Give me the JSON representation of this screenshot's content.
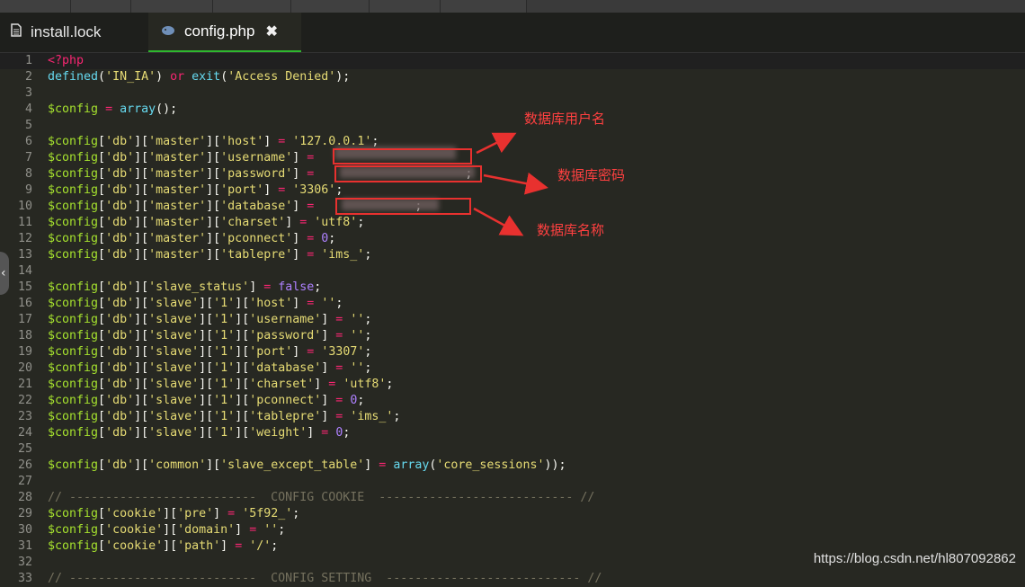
{
  "tabs": [
    {
      "label": "install.lock",
      "icon": "file-icon",
      "active": false
    },
    {
      "label": "config.php",
      "icon": "php-elephant-icon",
      "active": true,
      "close": "✖"
    }
  ],
  "annotations": {
    "username": "数据库用户名",
    "password": "数据库密码",
    "database": "数据库名称"
  },
  "watermark": "https://blog.csdn.net/hl807092862",
  "colors": {
    "accent_tab": "#2eb82e",
    "annotation": "#e8312f",
    "editor_bg": "#272822"
  },
  "lines": [
    {
      "n": "1",
      "t": [
        [
          "k",
          "<?php"
        ]
      ]
    },
    {
      "n": "2",
      "t": [
        [
          "f",
          "defined"
        ],
        [
          "p",
          "("
        ],
        [
          "s",
          "'IN_IA'"
        ],
        [
          "p",
          ") "
        ],
        [
          "k",
          "or"
        ],
        [
          "p",
          " "
        ],
        [
          "f",
          "exit"
        ],
        [
          "p",
          "("
        ],
        [
          "s",
          "'Access Denied'"
        ],
        [
          "p",
          ");"
        ]
      ]
    },
    {
      "n": "3",
      "t": []
    },
    {
      "n": "4",
      "t": [
        [
          "v",
          "$config"
        ],
        [
          "p",
          " "
        ],
        [
          "k",
          "="
        ],
        [
          "p",
          " "
        ],
        [
          "f",
          "array"
        ],
        [
          "p",
          "();"
        ]
      ]
    },
    {
      "n": "5",
      "t": []
    },
    {
      "n": "6",
      "t": [
        [
          "v",
          "$config"
        ],
        [
          "p",
          "["
        ],
        [
          "s",
          "'db'"
        ],
        [
          "p",
          "]["
        ],
        [
          "s",
          "'master'"
        ],
        [
          "p",
          "]["
        ],
        [
          "s",
          "'host'"
        ],
        [
          "p",
          "] "
        ],
        [
          "k",
          "="
        ],
        [
          "p",
          " "
        ],
        [
          "s",
          "'127.0.0.1'"
        ],
        [
          "p",
          ";"
        ]
      ]
    },
    {
      "n": "7",
      "t": [
        [
          "v",
          "$config"
        ],
        [
          "p",
          "["
        ],
        [
          "s",
          "'db'"
        ],
        [
          "p",
          "]["
        ],
        [
          "s",
          "'master'"
        ],
        [
          "p",
          "]["
        ],
        [
          "s",
          "'username'"
        ],
        [
          "p",
          "] "
        ],
        [
          "k",
          "="
        ],
        [
          "p",
          " "
        ]
      ]
    },
    {
      "n": "8",
      "t": [
        [
          "v",
          "$config"
        ],
        [
          "p",
          "["
        ],
        [
          "s",
          "'db'"
        ],
        [
          "p",
          "]["
        ],
        [
          "s",
          "'master'"
        ],
        [
          "p",
          "]["
        ],
        [
          "s",
          "'password'"
        ],
        [
          "p",
          "] "
        ],
        [
          "k",
          "="
        ],
        [
          "p",
          " "
        ],
        [
          "p",
          "                    ;"
        ]
      ]
    },
    {
      "n": "9",
      "t": [
        [
          "v",
          "$config"
        ],
        [
          "p",
          "["
        ],
        [
          "s",
          "'db'"
        ],
        [
          "p",
          "]["
        ],
        [
          "s",
          "'master'"
        ],
        [
          "p",
          "]["
        ],
        [
          "s",
          "'port'"
        ],
        [
          "p",
          "] "
        ],
        [
          "k",
          "="
        ],
        [
          "p",
          " "
        ],
        [
          "s",
          "'3306'"
        ],
        [
          "p",
          ";"
        ]
      ]
    },
    {
      "n": "10",
      "t": [
        [
          "v",
          "$config"
        ],
        [
          "p",
          "["
        ],
        [
          "s",
          "'db'"
        ],
        [
          "p",
          "]["
        ],
        [
          "s",
          "'master'"
        ],
        [
          "p",
          "]["
        ],
        [
          "s",
          "'database'"
        ],
        [
          "p",
          "] "
        ],
        [
          "k",
          "="
        ],
        [
          "p",
          " "
        ],
        [
          "p",
          "             ;"
        ]
      ]
    },
    {
      "n": "11",
      "t": [
        [
          "v",
          "$config"
        ],
        [
          "p",
          "["
        ],
        [
          "s",
          "'db'"
        ],
        [
          "p",
          "]["
        ],
        [
          "s",
          "'master'"
        ],
        [
          "p",
          "]["
        ],
        [
          "s",
          "'charset'"
        ],
        [
          "p",
          "] "
        ],
        [
          "k",
          "="
        ],
        [
          "p",
          " "
        ],
        [
          "s",
          "'utf8'"
        ],
        [
          "p",
          ";"
        ]
      ]
    },
    {
      "n": "12",
      "t": [
        [
          "v",
          "$config"
        ],
        [
          "p",
          "["
        ],
        [
          "s",
          "'db'"
        ],
        [
          "p",
          "]["
        ],
        [
          "s",
          "'master'"
        ],
        [
          "p",
          "]["
        ],
        [
          "s",
          "'pconnect'"
        ],
        [
          "p",
          "] "
        ],
        [
          "k",
          "="
        ],
        [
          "p",
          " "
        ],
        [
          "n",
          "0"
        ],
        [
          "p",
          ";"
        ]
      ]
    },
    {
      "n": "13",
      "t": [
        [
          "v",
          "$config"
        ],
        [
          "p",
          "["
        ],
        [
          "s",
          "'db'"
        ],
        [
          "p",
          "]["
        ],
        [
          "s",
          "'master'"
        ],
        [
          "p",
          "]["
        ],
        [
          "s",
          "'tablepre'"
        ],
        [
          "p",
          "] "
        ],
        [
          "k",
          "="
        ],
        [
          "p",
          " "
        ],
        [
          "s",
          "'ims_'"
        ],
        [
          "p",
          ";"
        ]
      ]
    },
    {
      "n": "14",
      "t": []
    },
    {
      "n": "15",
      "t": [
        [
          "v",
          "$config"
        ],
        [
          "p",
          "["
        ],
        [
          "s",
          "'db'"
        ],
        [
          "p",
          "]["
        ],
        [
          "s",
          "'slave_status'"
        ],
        [
          "p",
          "] "
        ],
        [
          "k",
          "="
        ],
        [
          "p",
          " "
        ],
        [
          "n",
          "false"
        ],
        [
          "p",
          ";"
        ]
      ]
    },
    {
      "n": "16",
      "t": [
        [
          "v",
          "$config"
        ],
        [
          "p",
          "["
        ],
        [
          "s",
          "'db'"
        ],
        [
          "p",
          "]["
        ],
        [
          "s",
          "'slave'"
        ],
        [
          "p",
          "]["
        ],
        [
          "s",
          "'1'"
        ],
        [
          "p",
          "]["
        ],
        [
          "s",
          "'host'"
        ],
        [
          "p",
          "] "
        ],
        [
          "k",
          "="
        ],
        [
          "p",
          " "
        ],
        [
          "s",
          "''"
        ],
        [
          "p",
          ";"
        ]
      ]
    },
    {
      "n": "17",
      "t": [
        [
          "v",
          "$config"
        ],
        [
          "p",
          "["
        ],
        [
          "s",
          "'db'"
        ],
        [
          "p",
          "]["
        ],
        [
          "s",
          "'slave'"
        ],
        [
          "p",
          "]["
        ],
        [
          "s",
          "'1'"
        ],
        [
          "p",
          "]["
        ],
        [
          "s",
          "'username'"
        ],
        [
          "p",
          "] "
        ],
        [
          "k",
          "="
        ],
        [
          "p",
          " "
        ],
        [
          "s",
          "''"
        ],
        [
          "p",
          ";"
        ]
      ]
    },
    {
      "n": "18",
      "t": [
        [
          "v",
          "$config"
        ],
        [
          "p",
          "["
        ],
        [
          "s",
          "'db'"
        ],
        [
          "p",
          "]["
        ],
        [
          "s",
          "'slave'"
        ],
        [
          "p",
          "]["
        ],
        [
          "s",
          "'1'"
        ],
        [
          "p",
          "]["
        ],
        [
          "s",
          "'password'"
        ],
        [
          "p",
          "] "
        ],
        [
          "k",
          "="
        ],
        [
          "p",
          " "
        ],
        [
          "s",
          "''"
        ],
        [
          "p",
          ";"
        ]
      ]
    },
    {
      "n": "19",
      "t": [
        [
          "v",
          "$config"
        ],
        [
          "p",
          "["
        ],
        [
          "s",
          "'db'"
        ],
        [
          "p",
          "]["
        ],
        [
          "s",
          "'slave'"
        ],
        [
          "p",
          "]["
        ],
        [
          "s",
          "'1'"
        ],
        [
          "p",
          "]["
        ],
        [
          "s",
          "'port'"
        ],
        [
          "p",
          "] "
        ],
        [
          "k",
          "="
        ],
        [
          "p",
          " "
        ],
        [
          "s",
          "'3307'"
        ],
        [
          "p",
          ";"
        ]
      ]
    },
    {
      "n": "20",
      "t": [
        [
          "v",
          "$config"
        ],
        [
          "p",
          "["
        ],
        [
          "s",
          "'db'"
        ],
        [
          "p",
          "]["
        ],
        [
          "s",
          "'slave'"
        ],
        [
          "p",
          "]["
        ],
        [
          "s",
          "'1'"
        ],
        [
          "p",
          "]["
        ],
        [
          "s",
          "'database'"
        ],
        [
          "p",
          "] "
        ],
        [
          "k",
          "="
        ],
        [
          "p",
          " "
        ],
        [
          "s",
          "''"
        ],
        [
          "p",
          ";"
        ]
      ]
    },
    {
      "n": "21",
      "t": [
        [
          "v",
          "$config"
        ],
        [
          "p",
          "["
        ],
        [
          "s",
          "'db'"
        ],
        [
          "p",
          "]["
        ],
        [
          "s",
          "'slave'"
        ],
        [
          "p",
          "]["
        ],
        [
          "s",
          "'1'"
        ],
        [
          "p",
          "]["
        ],
        [
          "s",
          "'charset'"
        ],
        [
          "p",
          "] "
        ],
        [
          "k",
          "="
        ],
        [
          "p",
          " "
        ],
        [
          "s",
          "'utf8'"
        ],
        [
          "p",
          ";"
        ]
      ]
    },
    {
      "n": "22",
      "t": [
        [
          "v",
          "$config"
        ],
        [
          "p",
          "["
        ],
        [
          "s",
          "'db'"
        ],
        [
          "p",
          "]["
        ],
        [
          "s",
          "'slave'"
        ],
        [
          "p",
          "]["
        ],
        [
          "s",
          "'1'"
        ],
        [
          "p",
          "]["
        ],
        [
          "s",
          "'pconnect'"
        ],
        [
          "p",
          "] "
        ],
        [
          "k",
          "="
        ],
        [
          "p",
          " "
        ],
        [
          "n",
          "0"
        ],
        [
          "p",
          ";"
        ]
      ]
    },
    {
      "n": "23",
      "t": [
        [
          "v",
          "$config"
        ],
        [
          "p",
          "["
        ],
        [
          "s",
          "'db'"
        ],
        [
          "p",
          "]["
        ],
        [
          "s",
          "'slave'"
        ],
        [
          "p",
          "]["
        ],
        [
          "s",
          "'1'"
        ],
        [
          "p",
          "]["
        ],
        [
          "s",
          "'tablepre'"
        ],
        [
          "p",
          "] "
        ],
        [
          "k",
          "="
        ],
        [
          "p",
          " "
        ],
        [
          "s",
          "'ims_'"
        ],
        [
          "p",
          ";"
        ]
      ]
    },
    {
      "n": "24",
      "t": [
        [
          "v",
          "$config"
        ],
        [
          "p",
          "["
        ],
        [
          "s",
          "'db'"
        ],
        [
          "p",
          "]["
        ],
        [
          "s",
          "'slave'"
        ],
        [
          "p",
          "]["
        ],
        [
          "s",
          "'1'"
        ],
        [
          "p",
          "]["
        ],
        [
          "s",
          "'weight'"
        ],
        [
          "p",
          "] "
        ],
        [
          "k",
          "="
        ],
        [
          "p",
          " "
        ],
        [
          "n",
          "0"
        ],
        [
          "p",
          ";"
        ]
      ]
    },
    {
      "n": "25",
      "t": []
    },
    {
      "n": "26",
      "t": [
        [
          "v",
          "$config"
        ],
        [
          "p",
          "["
        ],
        [
          "s",
          "'db'"
        ],
        [
          "p",
          "]["
        ],
        [
          "s",
          "'common'"
        ],
        [
          "p",
          "]["
        ],
        [
          "s",
          "'slave_except_table'"
        ],
        [
          "p",
          "] "
        ],
        [
          "k",
          "="
        ],
        [
          "p",
          " "
        ],
        [
          "f",
          "array"
        ],
        [
          "p",
          "("
        ],
        [
          "s",
          "'core_sessions'"
        ],
        [
          "p",
          "));"
        ]
      ]
    },
    {
      "n": "27",
      "t": []
    },
    {
      "n": "28",
      "t": [
        [
          "c",
          "// --------------------------  CONFIG COOKIE  --------------------------- //"
        ]
      ]
    },
    {
      "n": "29",
      "t": [
        [
          "v",
          "$config"
        ],
        [
          "p",
          "["
        ],
        [
          "s",
          "'cookie'"
        ],
        [
          "p",
          "]["
        ],
        [
          "s",
          "'pre'"
        ],
        [
          "p",
          "] "
        ],
        [
          "k",
          "="
        ],
        [
          "p",
          " "
        ],
        [
          "s",
          "'5f92_'"
        ],
        [
          "p",
          ";"
        ]
      ]
    },
    {
      "n": "30",
      "t": [
        [
          "v",
          "$config"
        ],
        [
          "p",
          "["
        ],
        [
          "s",
          "'cookie'"
        ],
        [
          "p",
          "]["
        ],
        [
          "s",
          "'domain'"
        ],
        [
          "p",
          "] "
        ],
        [
          "k",
          "="
        ],
        [
          "p",
          " "
        ],
        [
          "s",
          "''"
        ],
        [
          "p",
          ";"
        ]
      ]
    },
    {
      "n": "31",
      "t": [
        [
          "v",
          "$config"
        ],
        [
          "p",
          "["
        ],
        [
          "s",
          "'cookie'"
        ],
        [
          "p",
          "]["
        ],
        [
          "s",
          "'path'"
        ],
        [
          "p",
          "] "
        ],
        [
          "k",
          "="
        ],
        [
          "p",
          " "
        ],
        [
          "s",
          "'/'"
        ],
        [
          "p",
          ";"
        ]
      ]
    },
    {
      "n": "32",
      "t": []
    },
    {
      "n": "33",
      "t": [
        [
          "c",
          "// --------------------------  CONFIG SETTING  --------------------------- //"
        ]
      ]
    }
  ]
}
